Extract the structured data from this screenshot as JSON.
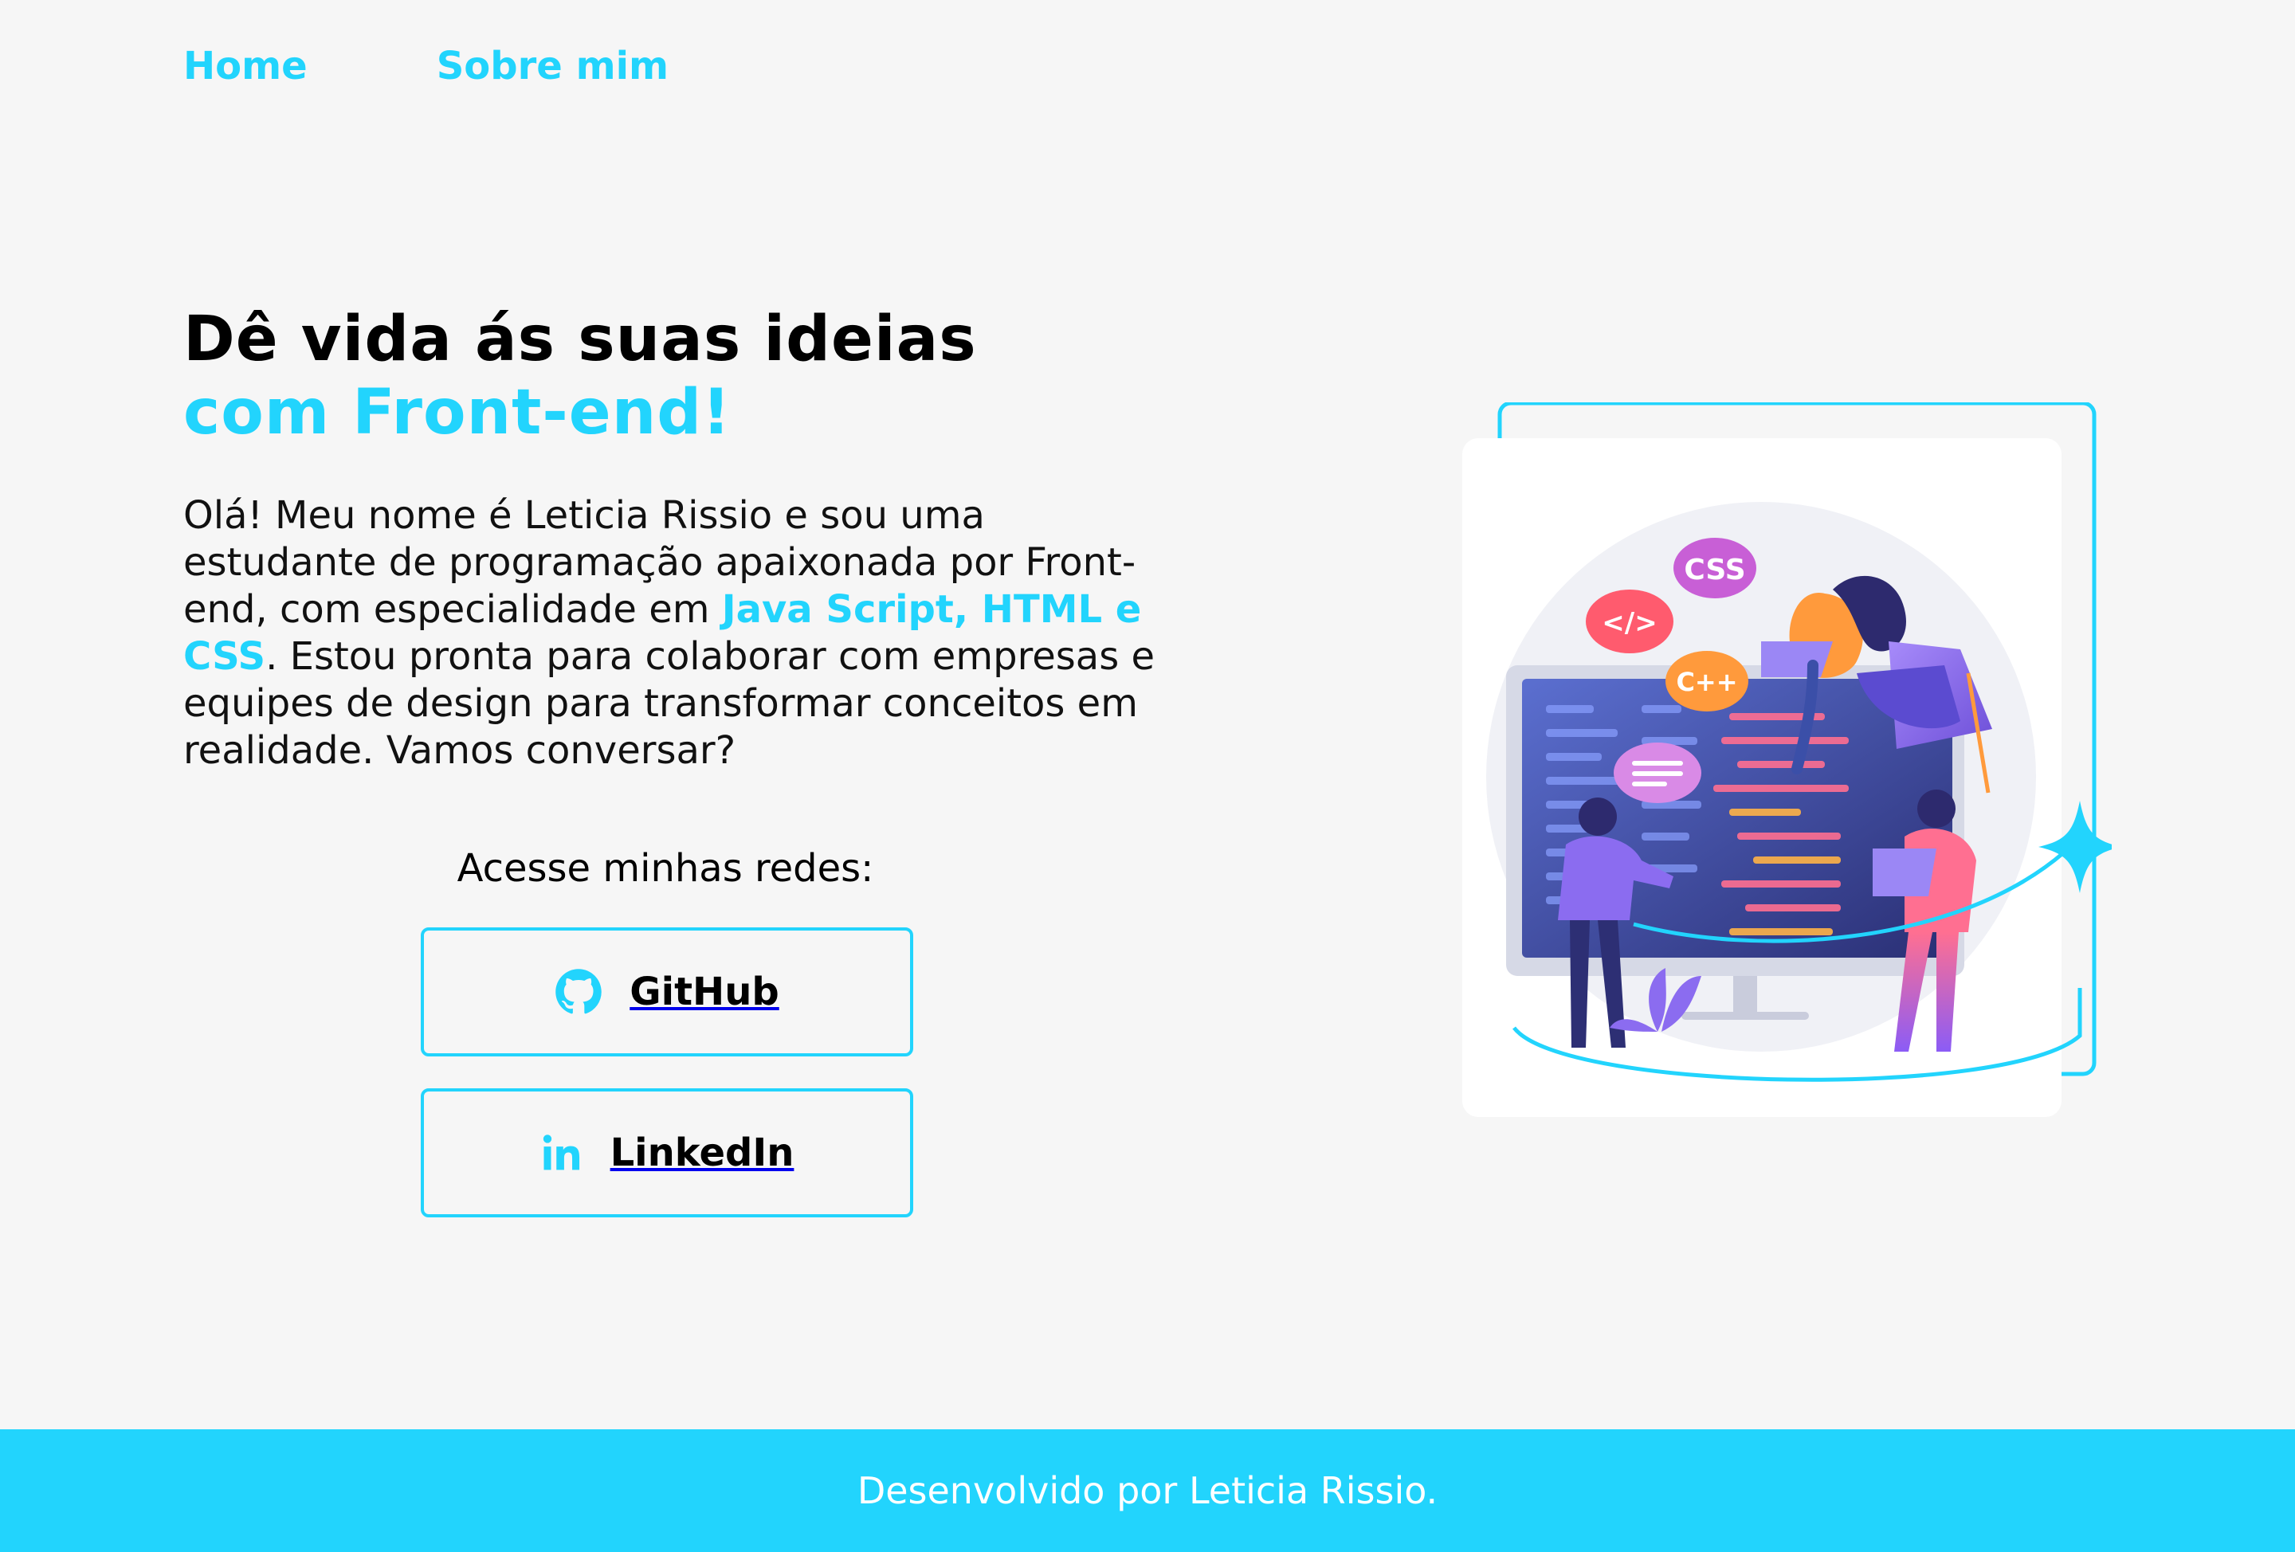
{
  "nav": {
    "home": "Home",
    "about": "Sobre mim"
  },
  "hero": {
    "title_line1": "Dê vida ás suas ideias",
    "title_line2": "com Front-end!",
    "intro_before": "Olá! Meu nome é Leticia Rissio e sou uma estudante de programação apaixonada por Front-end, com especialidade em ",
    "intro_highlight": "Java Script, HTML e CSS",
    "intro_after": ". Estou pronta para colaborar com empresas e equipes de design para transformar conceitos em realidade. Vamos conversar?"
  },
  "social": {
    "label": "Acesse minhas redes:",
    "github": "GitHub",
    "linkedin": "LinkedIn"
  },
  "illustration": {
    "badges": [
      "CSS",
      "</>",
      "C++"
    ]
  },
  "footer": {
    "text": "Desenvolvido por Leticia Rissio."
  },
  "colors": {
    "accent": "#22d4fd",
    "background": "#f6f6f6",
    "text": "#000000"
  }
}
